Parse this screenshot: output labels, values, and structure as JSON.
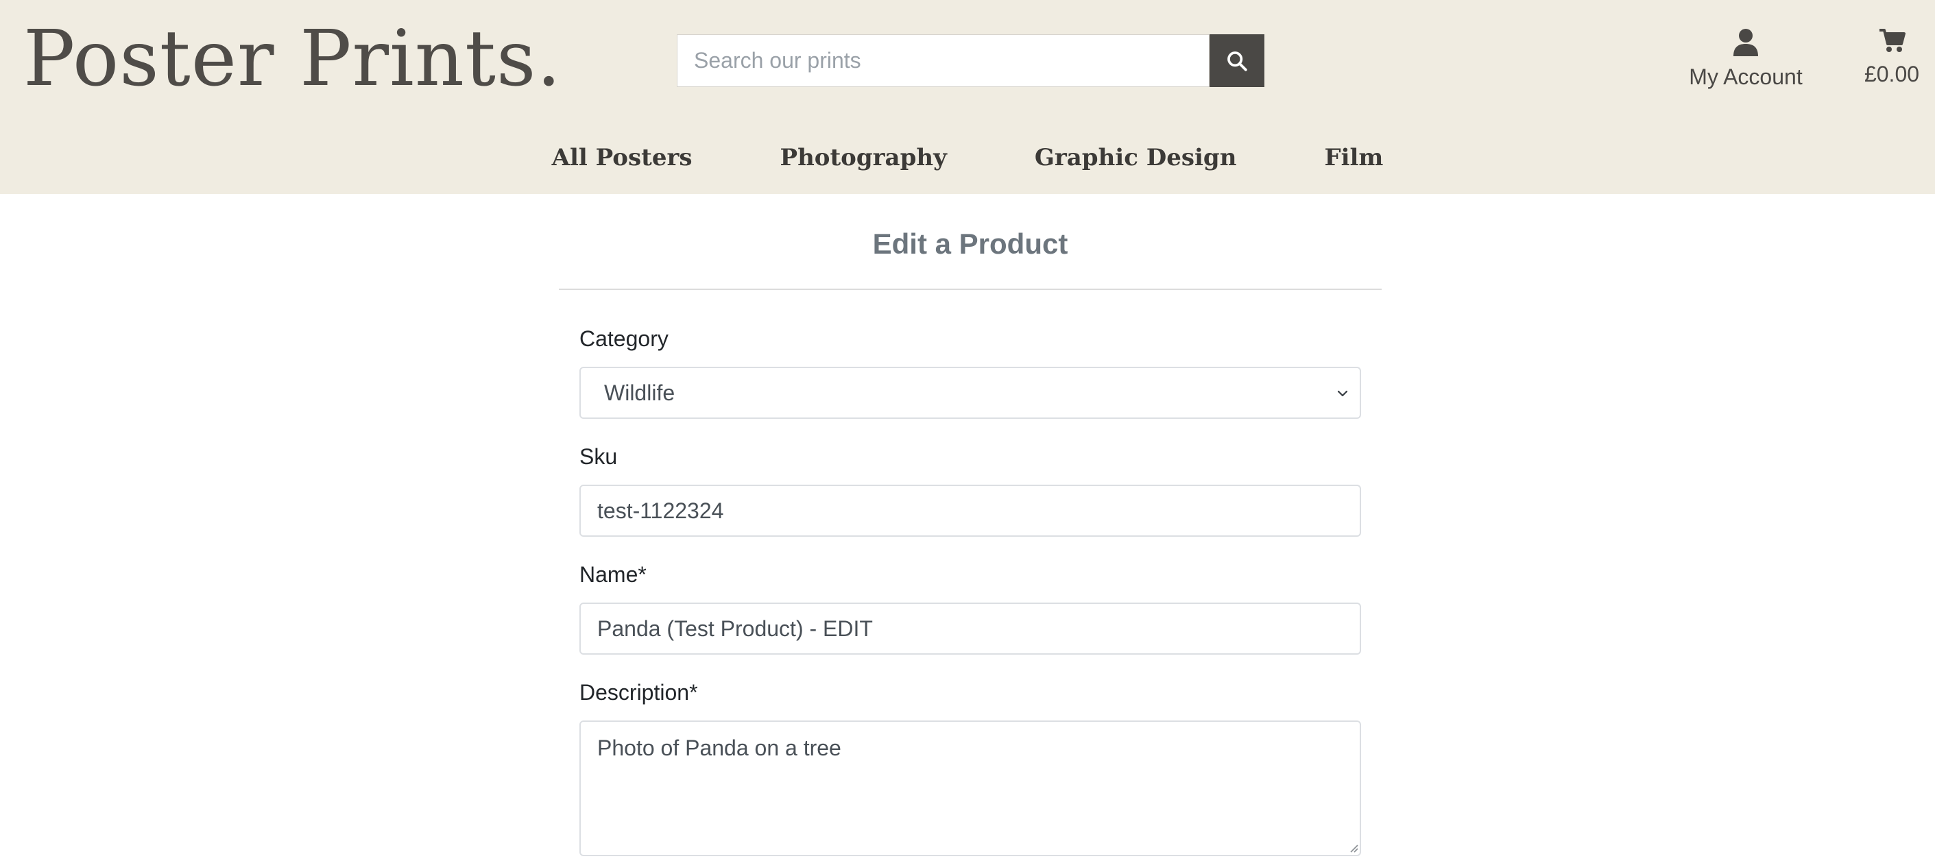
{
  "header": {
    "logo": "Poster Prints.",
    "search": {
      "placeholder": "Search our prints",
      "value": ""
    },
    "account_label": "My Account",
    "cart_total": "£0.00",
    "icons": {
      "search": "search-icon",
      "account": "user-icon",
      "cart": "cart-icon"
    }
  },
  "nav": {
    "items": [
      {
        "label": "All Posters"
      },
      {
        "label": "Photography"
      },
      {
        "label": "Graphic Design"
      },
      {
        "label": "Film"
      }
    ]
  },
  "form": {
    "title": "Edit a Product",
    "category": {
      "label": "Category",
      "value": "Wildlife"
    },
    "sku": {
      "label": "Sku",
      "value": "test-1122324"
    },
    "name": {
      "label": "Name*",
      "value": "Panda (Test Product) - EDIT"
    },
    "description": {
      "label": "Description*",
      "value": "Photo of Panda on a tree"
    }
  },
  "colors": {
    "header_bg": "#f0ece1",
    "logo_text": "#4f4c48",
    "search_button": "#4a4845",
    "title_text": "#6c757d"
  }
}
